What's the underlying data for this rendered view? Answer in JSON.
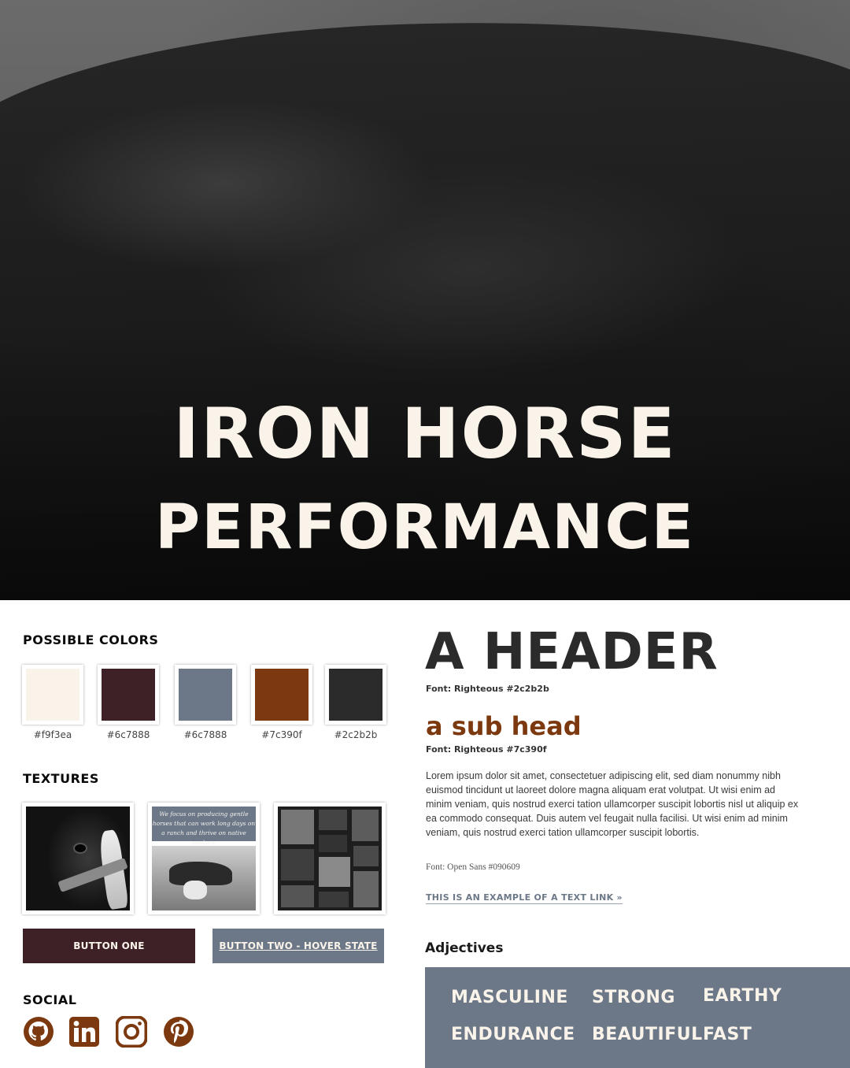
{
  "hero": {
    "title_line1": "IRON HORSE",
    "title_line2": "PERFORMANCE"
  },
  "colors": {
    "section_title": "POSSIBLE COLORS",
    "swatches": [
      {
        "hex": "#f9f3ea",
        "label": "#f9f3ea"
      },
      {
        "hex": "#3e2127",
        "label": "#6c7888"
      },
      {
        "hex": "#6c7888",
        "label": "#6c7888"
      },
      {
        "hex": "#7c390f",
        "label": "#7c390f"
      },
      {
        "hex": "#2c2b2b",
        "label": "#2c2b2b"
      }
    ]
  },
  "textures": {
    "section_title": "TEXTURES",
    "texture2_caption": "We focus on producing gentle horses that can work long days on a ranch and thrive on native pasture"
  },
  "buttons": {
    "one_label": "BUTTON ONE",
    "two_label": "BUTTON TWO - HOVER STATE"
  },
  "social": {
    "section_title": "SOCIAL",
    "icon_color": "#7c390f",
    "icons": [
      "github-icon",
      "linkedin-icon",
      "instagram-icon",
      "pinterest-icon"
    ]
  },
  "typography": {
    "header_text": "A HEADER",
    "header_font_note": "Font: Righteous #2c2b2b",
    "subhead_text": "a sub head",
    "subhead_font_note": "Font: Righteous #7c390f",
    "body_text": "Lorem ipsum dolor sit amet, consectetuer adipiscing elit, sed diam nonummy nibh euismod tincidunt ut laoreet dolore magna aliquam erat volutpat. Ut wisi enim ad minim veniam, quis nostrud exerci tation ullamcorper suscipit lobortis nisl ut aliquip ex ea commodo consequat. Duis autem vel feugait nulla facilisi. Ut wisi enim ad minim veniam, quis nostrud exerci tation ullamcorper suscipit lobortis.",
    "body_font_note": "Font: Open Sans #090609",
    "text_link": "THIS IS AN EXAMPLE OF A TEXT LINK »"
  },
  "adjectives": {
    "title": "Adjectives",
    "items": [
      "MASCULINE",
      "STRONG",
      "EARTHY",
      "ENDURANCE",
      "BEAUTIFUL",
      "FAST"
    ]
  }
}
